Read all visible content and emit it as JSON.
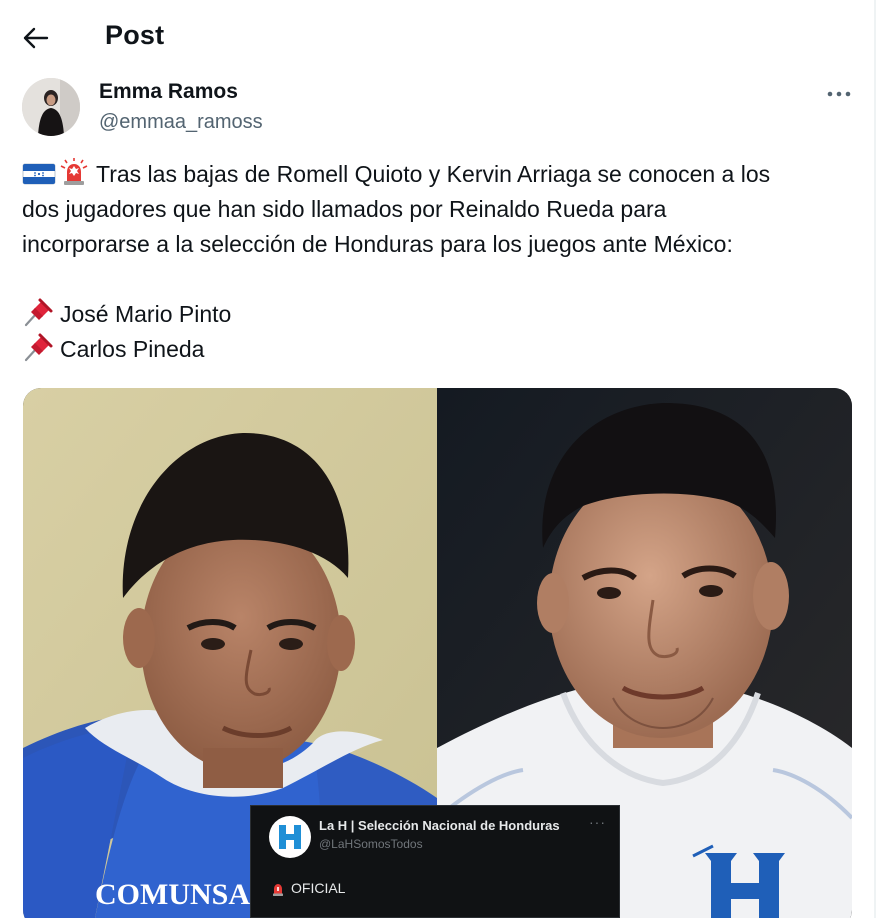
{
  "header": {
    "title": "Post",
    "back_icon": "arrow-left-icon"
  },
  "author": {
    "name": "Emma Ramos",
    "handle": "@emmaa_ramoss",
    "more_icon": "more-horizontal-icon"
  },
  "post": {
    "emoji_prefix": [
      "flag-honduras-icon",
      "police-siren-icon"
    ],
    "lines": [
      "Tras las bajas de Romell Quioto y Kervin Arriaga se conocen a los",
      "dos jugadores que han sido llamados por Reinaldo Rueda para",
      "incorporarse a la selección de Honduras para los juegos ante México:"
    ],
    "players": [
      "José Mario Pinto",
      "Carlos Pineda"
    ],
    "player_bullet_icon": "pushpin-icon"
  },
  "media": {
    "left_jersey_text": "COMUNSA",
    "embed": {
      "logo_letter": "H",
      "name": "La H | Selección Nacional de Honduras",
      "handle": "@LaHSomosTodos",
      "more": "···",
      "oficial": "OFICIAL",
      "oficial_icon": "police-siren-icon"
    }
  },
  "colors": {
    "text_primary": "#0f1419",
    "text_secondary": "#536471",
    "honduras_blue": "#0073cf"
  }
}
